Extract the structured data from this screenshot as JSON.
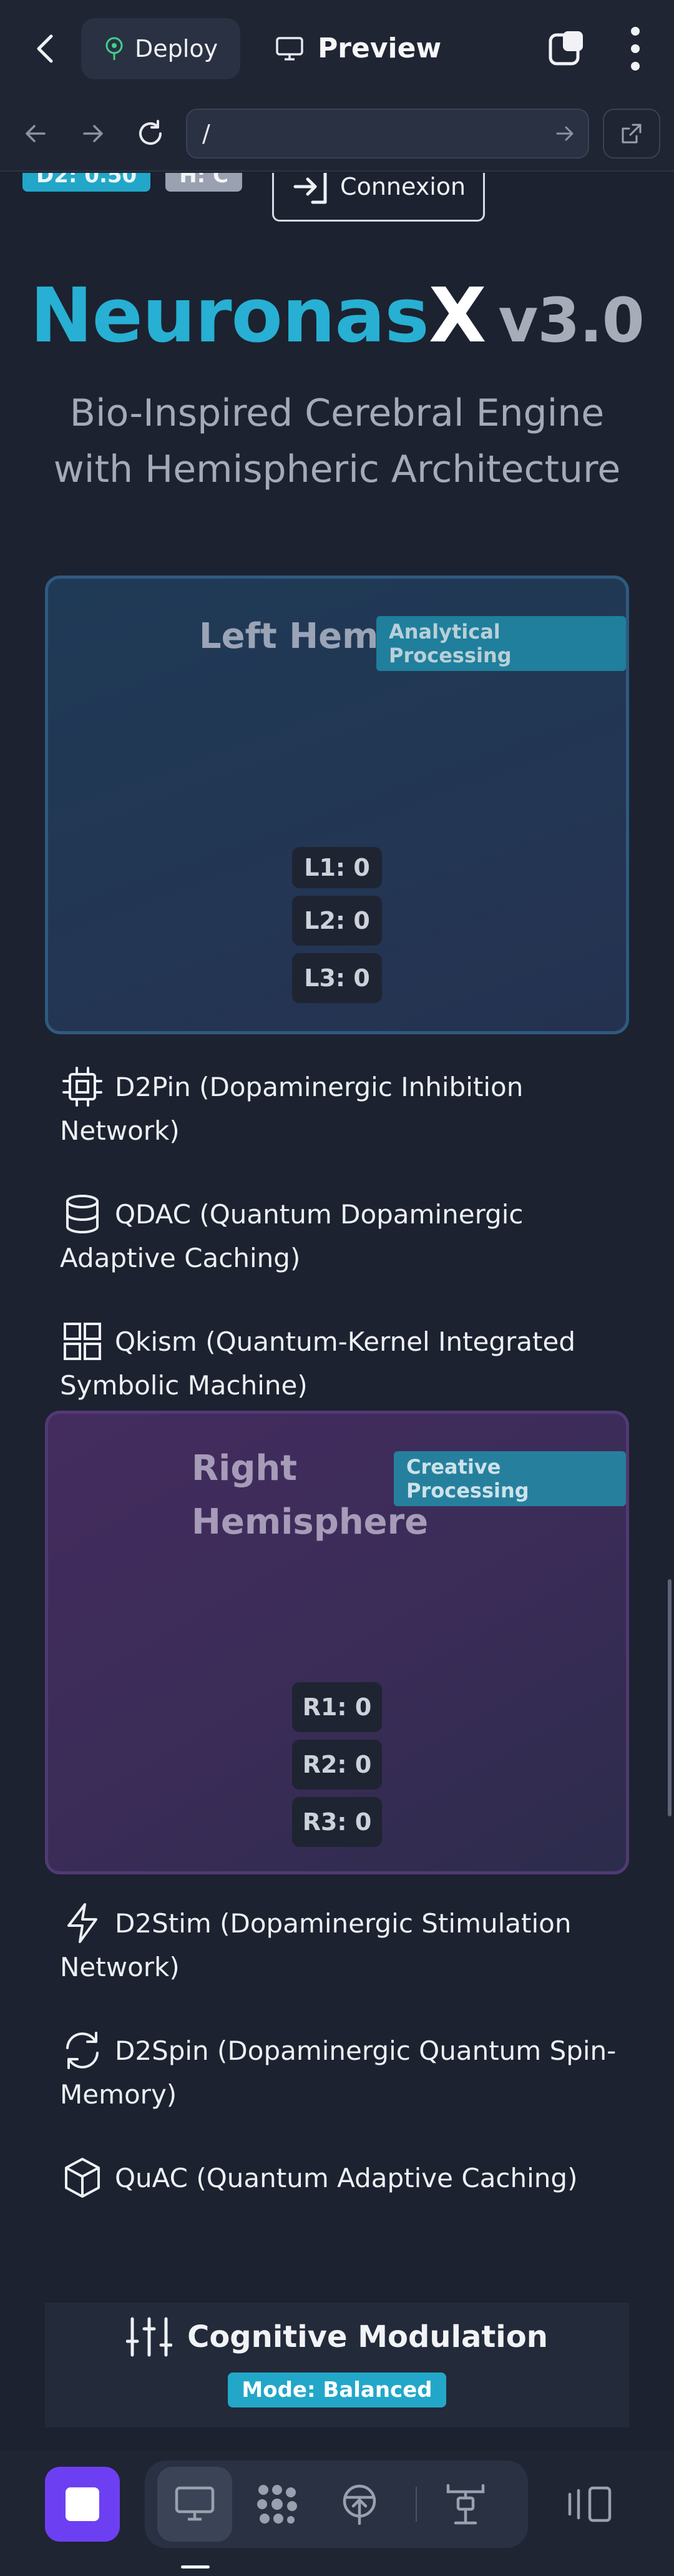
{
  "topbar": {
    "deploy_label": "Deploy",
    "preview_label": "Preview"
  },
  "address": {
    "url": "/"
  },
  "page": {
    "badges": {
      "d2": "D2: 0.50",
      "h": "H: C"
    },
    "connexion_label": "Connexion",
    "title_part1": "Neuronas",
    "title_part2": "X",
    "title_version": "v3.0",
    "subtitle": "Bio-Inspired Cerebral Engine with Hemispheric Architecture"
  },
  "left_hemisphere": {
    "title": "Left Hemis",
    "tag": "Analytical Processing",
    "layers": [
      "L1: 0",
      "L2: 0",
      "L3: 0"
    ],
    "modules": [
      {
        "icon": "cpu-icon",
        "label": "D2Pin (Dopaminergic Inhibition Network)"
      },
      {
        "icon": "database-icon",
        "label": "QDAC (Quantum Dopaminergic Adaptive Caching)"
      },
      {
        "icon": "grid-icon",
        "label": "Qkism (Quantum-Kernel Integrated Symbolic Machine)"
      }
    ]
  },
  "right_hemisphere": {
    "title": "Right Hemisphere",
    "tag": "Creative Processing",
    "layers": [
      "R1: 0",
      "R2: 0",
      "R3: 0"
    ],
    "modules": [
      {
        "icon": "lightning-icon",
        "label": "D2Stim (Dopaminergic Stimulation Network)"
      },
      {
        "icon": "refresh-icon",
        "label": "D2Spin (Dopaminergic Quantum Spin-Memory)"
      },
      {
        "icon": "cube-icon",
        "label": "QuAC (Quantum Adaptive Caching)"
      }
    ]
  },
  "cognitive": {
    "title": "Cognitive Modulation",
    "mode": "Mode: Balanced"
  },
  "colors": {
    "accent_cyan": "#22a7c9",
    "stop_purple": "#6d3ff2",
    "background": "#1c2230"
  }
}
